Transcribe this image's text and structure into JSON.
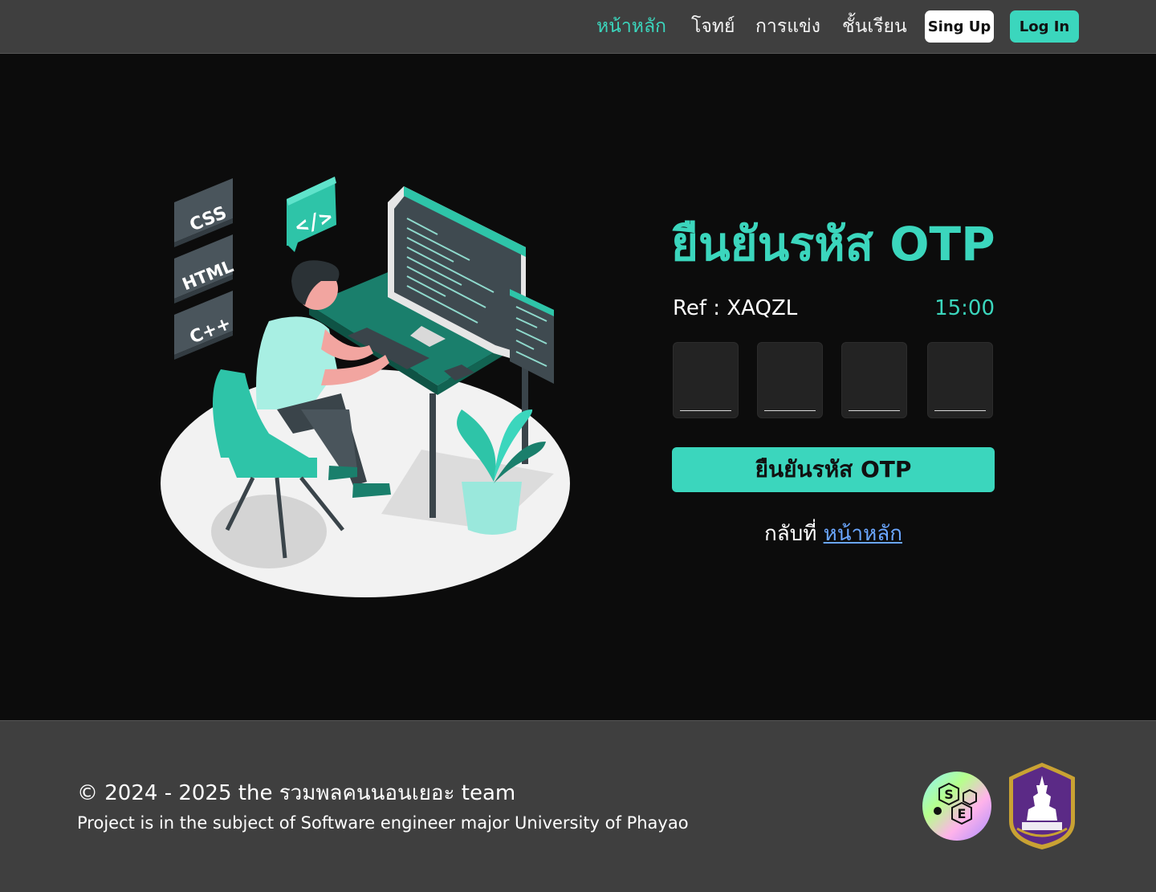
{
  "nav": {
    "links": [
      {
        "label": "หน้าหลัก",
        "active": true
      },
      {
        "label": "โจทย์",
        "active": false
      },
      {
        "label": "การแข่ง",
        "active": false
      },
      {
        "label": "ชั้นเรียน",
        "active": false
      }
    ],
    "signup_label": "Sing Up",
    "login_label": "Log In"
  },
  "illustration": {
    "tags": [
      "CSS",
      "HTML",
      "C++"
    ],
    "code_bubble": "</>"
  },
  "otp": {
    "title": "ยืนยันรหัส OTP",
    "ref_label": "Ref : XAQZL",
    "timer": "15:00",
    "digits": [
      "",
      "",
      "",
      ""
    ],
    "verify_label": "ยืนยันรหัส OTP",
    "back_text": "กลับที่",
    "back_link": "หน้าหลัก"
  },
  "footer": {
    "copyright": "© 2024 - 2025 the รวมพลคนนอนเยอะ team",
    "subtitle": "Project is in the subject of Software engineer major University of Phayao",
    "se_logo_letters": [
      "S",
      "E"
    ]
  },
  "colors": {
    "accent": "#3bd6bd",
    "nav_bg": "#3f3f3f",
    "page_bg": "#0c0c0c",
    "link": "#6aa6ff",
    "university_purple": "#5b2a86"
  }
}
